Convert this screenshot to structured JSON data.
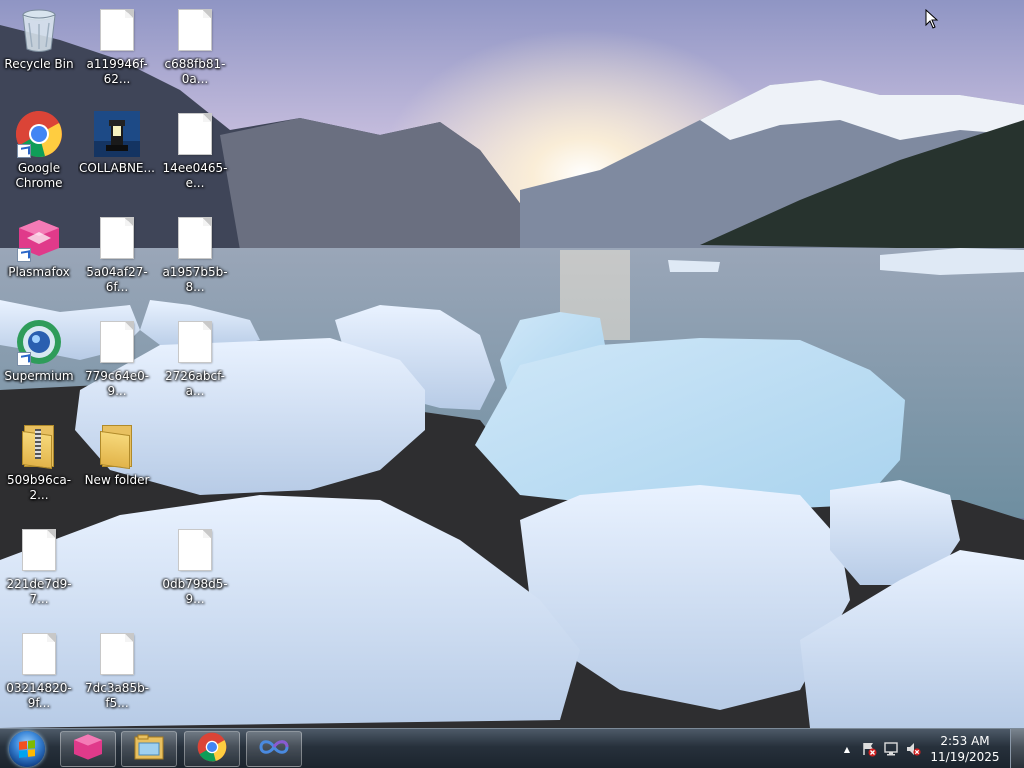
{
  "desktop": {
    "icons": [
      {
        "label": "Recycle Bin",
        "kind": "recycle-bin"
      },
      {
        "label": "a119946f-62...",
        "kind": "file"
      },
      {
        "label": "c688fb81-0a...",
        "kind": "file"
      },
      {
        "label": "Google Chrome",
        "kind": "chrome",
        "shortcut": true
      },
      {
        "label": "COLLABNE...",
        "kind": "lighthouse"
      },
      {
        "label": "14ee0465-e...",
        "kind": "file"
      },
      {
        "label": "Plasmafox",
        "kind": "plasmafox",
        "shortcut": true
      },
      {
        "label": "5a04af27-6f...",
        "kind": "file"
      },
      {
        "label": "a1957b5b-8...",
        "kind": "file"
      },
      {
        "label": "Supermium",
        "kind": "supermium",
        "shortcut": true
      },
      {
        "label": "779c64e0-9...",
        "kind": "file"
      },
      {
        "label": "2726abcf-a...",
        "kind": "file"
      },
      {
        "label": "509b96ca-2...",
        "kind": "zip-folder"
      },
      {
        "label": "New folder",
        "kind": "folder"
      },
      {
        "label": "221de7d9-7...",
        "kind": "file"
      },
      {
        "label": "0db798d5-9...",
        "kind": "file"
      },
      {
        "label": "03214820-9f...",
        "kind": "file"
      },
      {
        "label": "7dc3a85b-f5...",
        "kind": "file"
      }
    ]
  },
  "taskbar": {
    "start_icon": "windows-orb-icon",
    "pinned": [
      {
        "name": "plasmafox-icon"
      },
      {
        "name": "file-explorer-icon"
      },
      {
        "name": "chrome-icon"
      },
      {
        "name": "supermium-loop-icon"
      }
    ],
    "tray": {
      "overflow_glyph": "▲",
      "time": "2:53 AM",
      "date": "11/19/2025"
    }
  },
  "colors": {
    "taskbar_top": "#4d5a68",
    "taskbar_bottom": "#1c242d",
    "accent_blue": "#3a86d8"
  }
}
